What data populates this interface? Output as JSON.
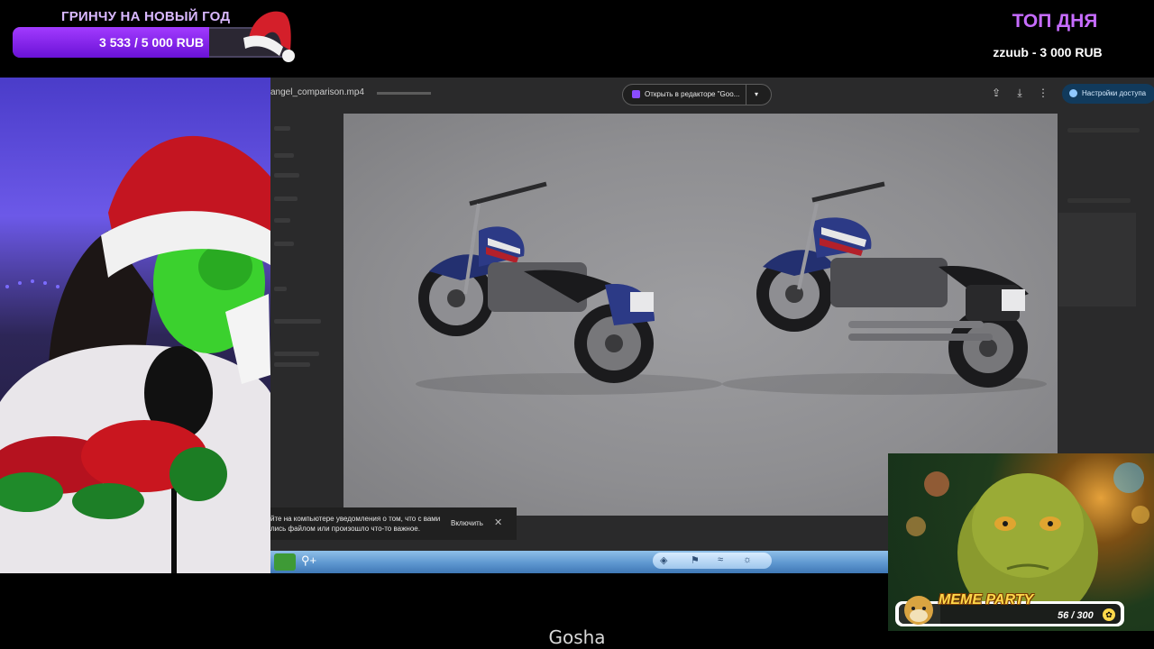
{
  "goal": {
    "title": "ГРИНЧУ НА НОВЫЙ ГОД",
    "amount_text": "3 533 / 5 000 RUB",
    "progress": 0.7066
  },
  "top_of_day": {
    "title": "ТОП ДНЯ",
    "entry": "zzuub - 3 000 RUB"
  },
  "screen": {
    "file_name": "angel_comparison.mp4",
    "open_in_editor": "Открыть в редакторе \"Goo...",
    "access_settings": "Настройки доступа",
    "icons": [
      "drive-add-icon",
      "download-icon",
      "more-vert-icon"
    ]
  },
  "notification": {
    "text": "йте на компьютере уведомления о том, что с вами лись файлом или произошло что-то важное.",
    "enable_label": "Включить",
    "close_label": "✕"
  },
  "meme_party": {
    "title": "MEME PARTY",
    "count_text": "56 / 300",
    "progress": 0.1867
  },
  "caption": "Gosha",
  "colors": {
    "goal_fill": "#8a2be2",
    "top_title": "#c66cff",
    "taskbar": "#5e97d0",
    "meme_title": "#ffd94b"
  }
}
